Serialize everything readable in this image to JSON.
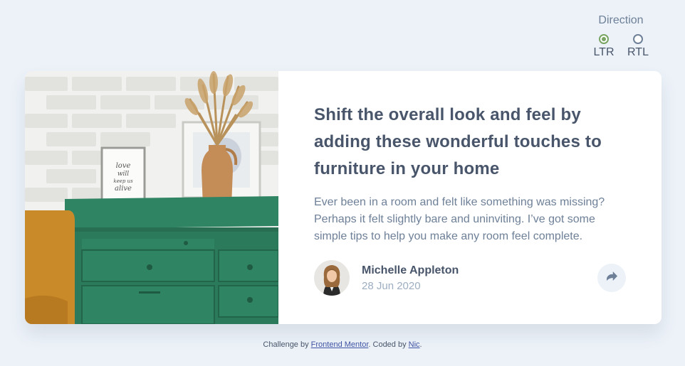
{
  "direction": {
    "title": "Direction",
    "options": [
      {
        "label": "LTR",
        "checked": true
      },
      {
        "label": "RTL",
        "checked": false
      }
    ]
  },
  "card": {
    "headline": "Shift the overall look and feel by adding these wonderful touches to furniture in your home",
    "excerpt": "Ever been in a room and felt like something was missing? Perhaps it felt slightly bare and uninviting. I’ve got some simple tips to help you make any room feel complete.",
    "author": {
      "name": "Michelle Appleton",
      "date": "28 Jun 2020"
    },
    "share_icon": "share-icon",
    "image_frame_text": "love will keep us alive"
  },
  "footer": {
    "prefix": "Challenge by ",
    "link1": "Frontend Mentor",
    "middle": ". Coded by ",
    "link2": "Nic",
    "suffix": "."
  },
  "colors": {
    "background": "#ECF2F8",
    "heading": "#48556A",
    "text": "#6E8098",
    "muted": "#9DAEC2",
    "radio_active": "#78A563",
    "dresser": "#2E7D5E"
  }
}
